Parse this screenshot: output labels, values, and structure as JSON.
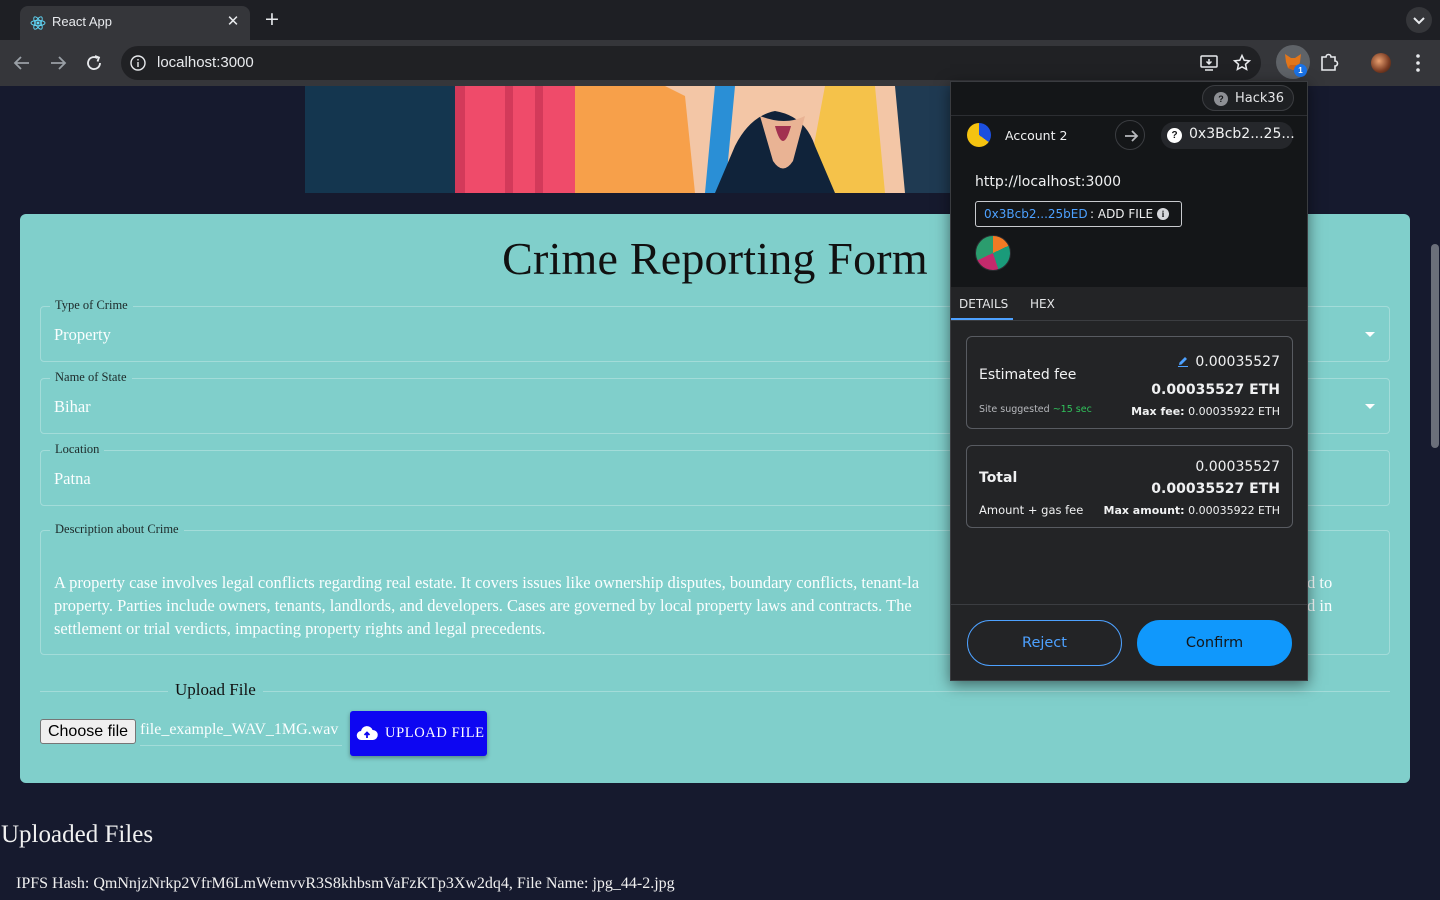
{
  "browser": {
    "tab_title": "React App",
    "url": "localhost:3000"
  },
  "form": {
    "title": "Crime Reporting Form",
    "crime_type": {
      "label": "Type of Crime",
      "value": "Property"
    },
    "state": {
      "label": "Name of State",
      "value": "Bihar"
    },
    "location": {
      "label": "Location",
      "value": "Patna"
    },
    "description": {
      "label": "Description about Crime",
      "value": "A property case involves legal conflicts regarding real estate. It covers issues like ownership disputes, boundary conflicts, tenant-la... d to property. Parties include owners, tenants, landlords, and developers. Cases are governed by local property laws and contracts. The ... d in settlement or trial verdicts, impacting property rights and legal precedents.",
      "line1": "A property case involves legal conflicts regarding real estate. It covers issues like ownership disputes, boundary conflicts, tenant-la",
      "line1_end": "d to",
      "line2": "property. Parties include owners, tenants, landlords, and developers. Cases are governed by local property laws and contracts. The",
      "line2_end": "d in",
      "line3": "settlement or trial verdicts, impacting property rights and legal precedents."
    },
    "upload": {
      "label": "Upload File",
      "choose_label": "Choose file",
      "file_name": "file_example_WAV_1MG.wav",
      "button_label": "UPLOAD FILE"
    }
  },
  "uploaded": {
    "title": "Uploaded Files",
    "items": [
      "IPFS Hash: QmNnjzNrkp2VfrM6LmWemvvR3S8khbsmVaFzKTp3Xw2dq4, File Name: jpg_44-2.jpg"
    ]
  },
  "metamask": {
    "network": "Hack36",
    "account_name": "Account 2",
    "to_address": "0x3Bcb2...25...",
    "origin": "http://localhost:3000",
    "contract_address": "0x3Bcb2...25bED",
    "method": ": ADD FILE",
    "tabs": [
      "DETAILS",
      "HEX"
    ],
    "estimated_fee": {
      "label": "Estimated fee",
      "edit_value": "0.00035527",
      "eth_value": "0.00035527 ETH",
      "site_suggested": "Site suggested",
      "time": "~15 sec",
      "max_fee_label": "Max fee:",
      "max_fee_value": "0.00035922 ETH"
    },
    "total": {
      "label": "Total",
      "value": "0.00035527",
      "eth_value": "0.00035527 ETH",
      "sub_label": "Amount + gas fee",
      "max_amount_label": "Max amount:",
      "max_amount_value": "0.00035922 ETH"
    },
    "reject_label": "Reject",
    "confirm_label": "Confirm"
  }
}
